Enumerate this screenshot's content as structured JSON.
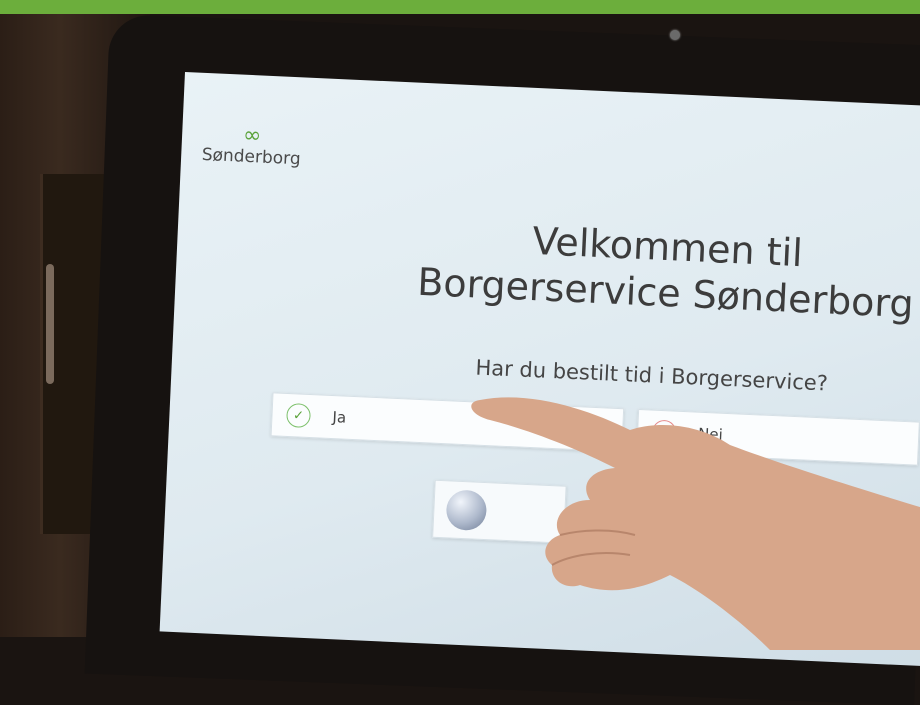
{
  "kiosk": {
    "logo_mark": "∞",
    "logo_text": "Sønderborg",
    "welcome_line1": "Velkommen til",
    "welcome_line2": "Borgerservice Sønderborg",
    "question": "Har du bestilt tid i Borgerservice?",
    "yes_label": "Ja",
    "no_label": "Nej",
    "yes_icon": "check-circle-icon",
    "no_icon": "x-circle-icon"
  },
  "colors": {
    "brand_green": "#6cae3c",
    "yes_accent": "#5aa23a",
    "no_accent": "#d85757"
  }
}
